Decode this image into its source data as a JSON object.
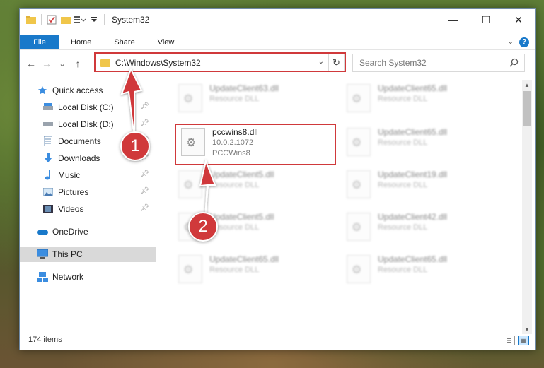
{
  "window": {
    "title": "System32",
    "minimize": "—",
    "maximize": "☐",
    "close": "✕"
  },
  "ribbon": {
    "file": "File",
    "home": "Home",
    "share": "Share",
    "view": "View"
  },
  "nav": {
    "back": "←",
    "forward": "→",
    "recent": "⌄",
    "up": "↑"
  },
  "address": {
    "path": "C:\\Windows\\System32"
  },
  "search": {
    "placeholder": "Search System32"
  },
  "sidebar": {
    "items": [
      {
        "label": "Quick access"
      },
      {
        "label": "Local Disk (C:)"
      },
      {
        "label": "Local Disk (D:)"
      },
      {
        "label": "Documents"
      },
      {
        "label": "Downloads"
      },
      {
        "label": "Music"
      },
      {
        "label": "Pictures"
      },
      {
        "label": "Videos"
      },
      {
        "label": "OneDrive"
      },
      {
        "label": "This PC"
      },
      {
        "label": "Network"
      }
    ]
  },
  "files": [
    {
      "name": "UpdateClient63.dll",
      "type": "Resource DLL"
    },
    {
      "name": "UpdateClient65.dll",
      "type": "Resource DLL"
    },
    {
      "name": "pccwins8.dll",
      "version": "10.0.2.1072",
      "desc": "PCCWins8"
    },
    {
      "name": "UpdateClient65.dll",
      "type": "Resource DLL"
    },
    {
      "name": "UpdateClient5.dll",
      "type": "Resource DLL"
    },
    {
      "name": "UpdateClient19.dll",
      "type": "Resource DLL"
    },
    {
      "name": "UpdateClient5.dll",
      "type": "Resource DLL"
    },
    {
      "name": "UpdateClient42.dll",
      "type": "Resource DLL"
    },
    {
      "name": "UpdateClient65.dll",
      "type": "Resource DLL"
    },
    {
      "name": "UpdateClient65.dll",
      "type": "Resource DLL"
    }
  ],
  "status": {
    "count": "174 items"
  },
  "annotations": {
    "step1": "1",
    "step2": "2",
    "highlight_color": "#d0393b"
  }
}
